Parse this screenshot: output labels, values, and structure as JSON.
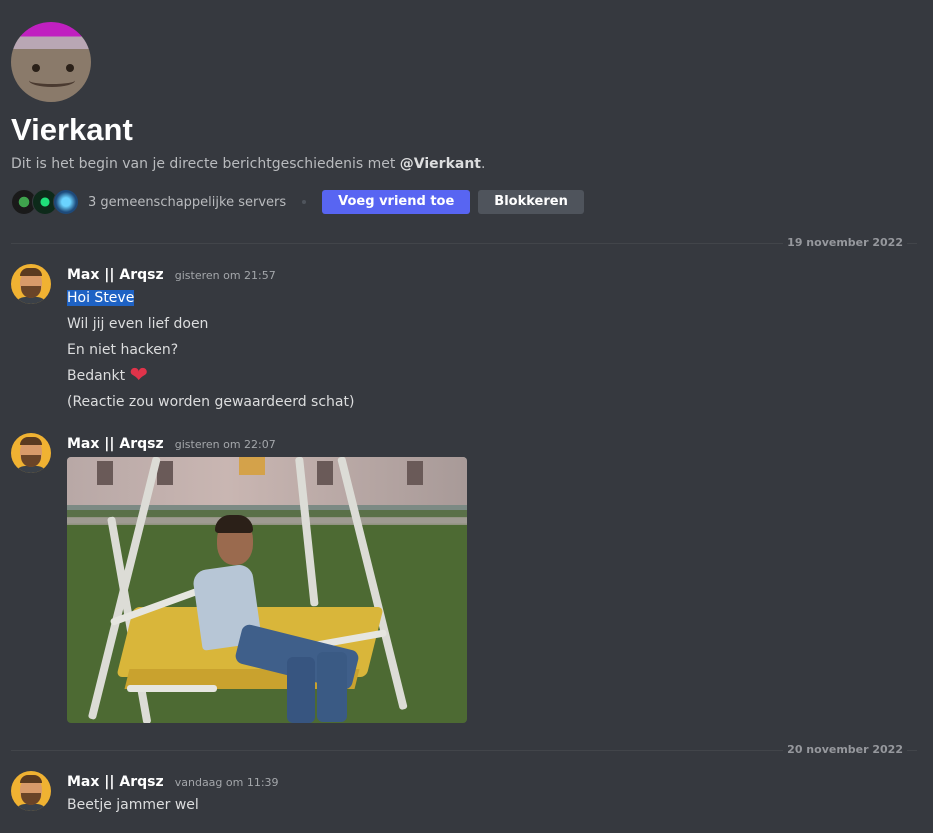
{
  "dm": {
    "name": "Vierkant",
    "intro_prefix": "Dit is het begin van je directe berichtgeschiedenis met ",
    "intro_handle": "@Vierkant",
    "intro_suffix": ".",
    "mutual_servers": "3 gemeenschappelijke servers",
    "add_friend": "Voeg vriend toe",
    "block": "Blokkeren"
  },
  "dividers": [
    "19 november 2022",
    "20 november 2022"
  ],
  "messages": [
    {
      "author": "Max || Arqsz",
      "time": "gisteren om 21:57",
      "lines": [
        "Hoi Steve",
        "Wil jij even lief doen",
        "En niet hacken?",
        "Bedankt",
        "(Reactie zou worden gewaardeerd schat)"
      ],
      "emoji": "❤"
    },
    {
      "author": "Max || Arqsz",
      "time": "gisteren om 22:07"
    },
    {
      "author": "Max || Arqsz",
      "time": "vandaag om 11:39",
      "lines": [
        "Beetje jammer wel"
      ]
    }
  ],
  "colors": {
    "background": "#36393f",
    "primary_button": "#5865f2",
    "secondary_button": "#4f545c",
    "selection": "#1e62c4",
    "heart": "#e0334a"
  },
  "icons": [
    "server-icon",
    "server-icon",
    "server-icon",
    "heart-emoji"
  ]
}
